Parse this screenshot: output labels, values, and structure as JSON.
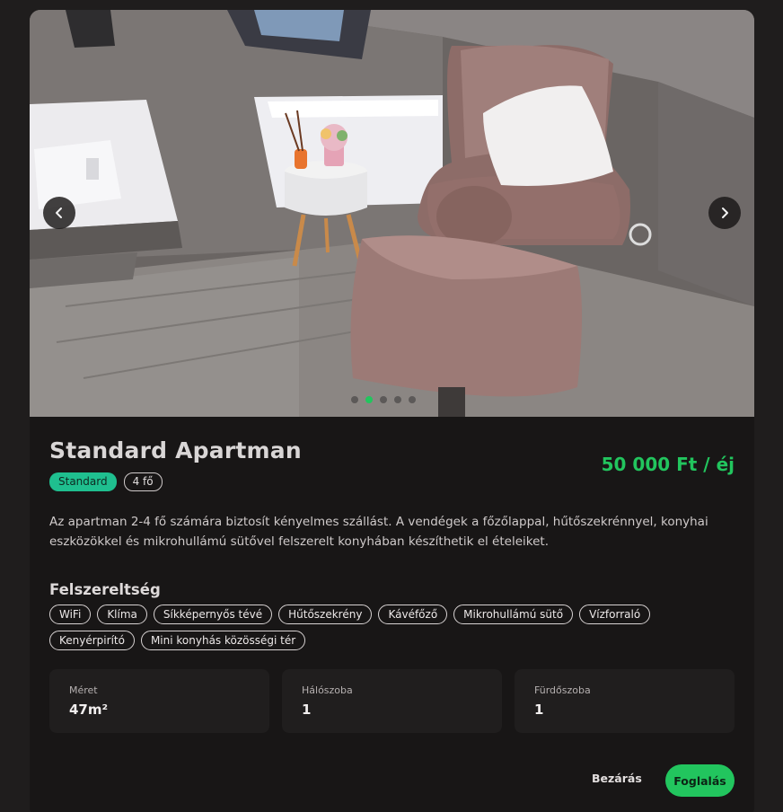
{
  "room": {
    "title": "Standard Apartman",
    "price": "50 000 Ft / éj",
    "category": "Standard",
    "capacity": "4 fő",
    "description": "Az apartman 2-4 fő számára biztosít kényelmes szállást. A vendégek a főzőlappal, hűtőszekrénnyel, konyhai eszközökkel és mikrohullámú sütővel felszerelt konyhában készíthetik el ételeiket."
  },
  "gallery": {
    "image_count": 5,
    "active_index": 1,
    "prev_icon": "chevron-left-icon",
    "next_icon": "chevron-right-icon"
  },
  "amenities_section": {
    "title": "Felszereltség",
    "items": [
      "WiFi",
      "Klíma",
      "Síkképernyős tévé",
      "Hűtőszekrény",
      "Kávéfőző",
      "Mikrohullámú sütő",
      "Vízforraló",
      "Kenyérpirító",
      "Mini konyhás közösségi tér"
    ]
  },
  "stats": [
    {
      "label": "Méret",
      "value": "47m²"
    },
    {
      "label": "Hálószoba",
      "value": "1"
    },
    {
      "label": "Fürdőszoba",
      "value": "1"
    }
  ],
  "actions": {
    "close_label": "Bezárás",
    "book_label": "Foglalás"
  },
  "colors": {
    "accent": "#22c55e",
    "category_badge": "#1fbf8f",
    "background": "#1f1d1d",
    "card": "#181616"
  }
}
